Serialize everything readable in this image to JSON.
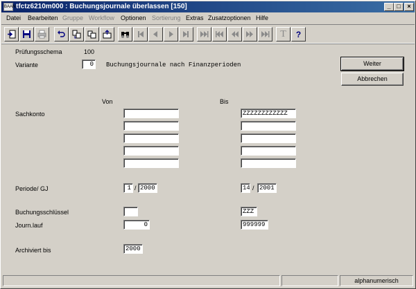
{
  "window": {
    "app_icon": "BAAN",
    "title": "tfctz6210m000 : Buchungsjournale überlassen [150]",
    "controls": [
      "_",
      "□",
      "×"
    ]
  },
  "menu": [
    "Datei",
    "Bearbeiten",
    "Gruppe",
    "Workflow",
    "Optionen",
    "Sortierung",
    "Extras",
    "Zusatzoptionen",
    "Hilfe"
  ],
  "toolbar": {
    "icons": [
      "exit-icon",
      "save-icon",
      "print-icon",
      "undo-icon",
      "copy-icon",
      "duplicate-icon",
      "export-icon",
      "find-icon",
      "first-record-icon",
      "previous-record-icon",
      "next-record-icon",
      "last-record-icon",
      "first-set-icon",
      "previous-set-first-icon",
      "previous-set-icon",
      "next-set-icon",
      "last-set-icon",
      "text-icon",
      "help-icon"
    ],
    "text_glyph": "T",
    "help_glyph": "?"
  },
  "form": {
    "pruefungsschema_label": "Prüfungsschema",
    "pruefungsschema_value": "100",
    "variante_label": "Variante",
    "variante_value": "0",
    "variante_desc": "Buchungsjournale nach Finanzperioden",
    "von_header": "Von",
    "bis_header": "Bis",
    "sachkonto_label": "Sachkonto",
    "sachkonto_von": [
      "",
      "",
      "",
      "",
      ""
    ],
    "sachkonto_bis": [
      "ZZZZZZZZZZZZ",
      "",
      "",
      "",
      ""
    ],
    "periode_label": "Periode/ GJ",
    "von_periode": "1",
    "von_separator": "/",
    "von_gj": "2000",
    "bis_periode": "14",
    "bis_separator": "/",
    "bis_gj": "2001",
    "buchungsschluessel_label": "Buchungsschlüssel",
    "buchungsschluessel_von": "",
    "buchungsschluessel_bis": "ZZZ",
    "journlauf_label": "Journ.lauf",
    "journlauf_von": "0",
    "journlauf_bis": "999999",
    "archiviert_label": "Archiviert bis",
    "archiviert_value": "2000"
  },
  "buttons": {
    "weiter": "Weiter",
    "abbrechen": "Abbrechen"
  },
  "status": {
    "pane1": "",
    "pane2": "",
    "pane3": "alphanumerisch"
  }
}
